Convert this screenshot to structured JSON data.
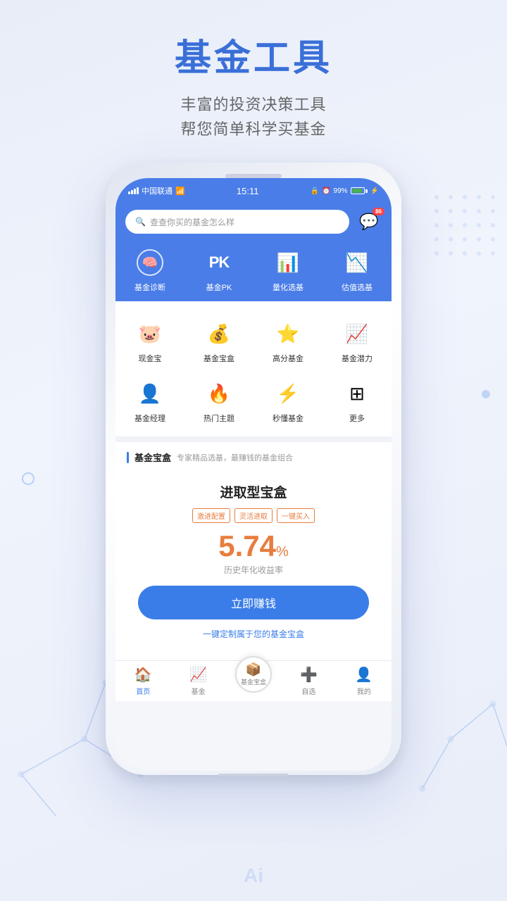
{
  "header": {
    "main_title": "基金工具",
    "subtitle_line1": "丰富的投资决策工具",
    "subtitle_line2": "帮您简单科学买基金"
  },
  "status_bar": {
    "carrier": "中国联通",
    "time": "15:11",
    "battery": "99%"
  },
  "search": {
    "placeholder": "查查你买的基金怎么样",
    "message_badge": "86"
  },
  "top_nav": {
    "items": [
      {
        "label": "基金诊断",
        "icon": "brain"
      },
      {
        "label": "基金PK",
        "icon": "pk"
      },
      {
        "label": "量化选基",
        "icon": "chart"
      },
      {
        "label": "估值选基",
        "icon": "trend"
      }
    ]
  },
  "icon_grid": {
    "rows": [
      [
        {
          "label": "现金宝",
          "icon": "🐷",
          "color": "ic-orange"
        },
        {
          "label": "基金宝盒",
          "icon": "💰",
          "color": "ic-gold"
        },
        {
          "label": "高分基金",
          "icon": "⭐",
          "color": "ic-red"
        },
        {
          "label": "基金潜力",
          "icon": "📈",
          "color": "ic-blue"
        }
      ],
      [
        {
          "label": "基金经理",
          "icon": "👤",
          "color": "ic-blue"
        },
        {
          "label": "热门主题",
          "icon": "🔥",
          "color": "ic-flame"
        },
        {
          "label": "秒懂基金",
          "icon": "📊",
          "color": "ic-teal"
        },
        {
          "label": "更多",
          "icon": "⊞",
          "color": "ic-gray"
        }
      ]
    ]
  },
  "fund_box_section": {
    "bar_color": "#3a7de8",
    "title": "基金宝盒",
    "description": "专家精品选基，最赚钱的基金组合",
    "card": {
      "title": "进取型宝盒",
      "tags": [
        "激进配置",
        "灵活进取",
        "一键买入"
      ],
      "rate": "5.74",
      "rate_unit": "%",
      "rate_label": "历史年化收益率",
      "earn_button": "立即赚钱",
      "custom_link": "一键定制属于您的基金宝盒"
    }
  },
  "bottom_nav": {
    "items": [
      {
        "label": "首页",
        "icon": "🏠",
        "active": true
      },
      {
        "label": "基金",
        "icon": "📈",
        "active": false
      },
      {
        "label": "基金宝盒",
        "icon": "📦",
        "center": true
      },
      {
        "label": "自选",
        "icon": "➕",
        "active": false
      },
      {
        "label": "我的",
        "icon": "👤",
        "active": false
      }
    ]
  },
  "ai_label": "Ai"
}
